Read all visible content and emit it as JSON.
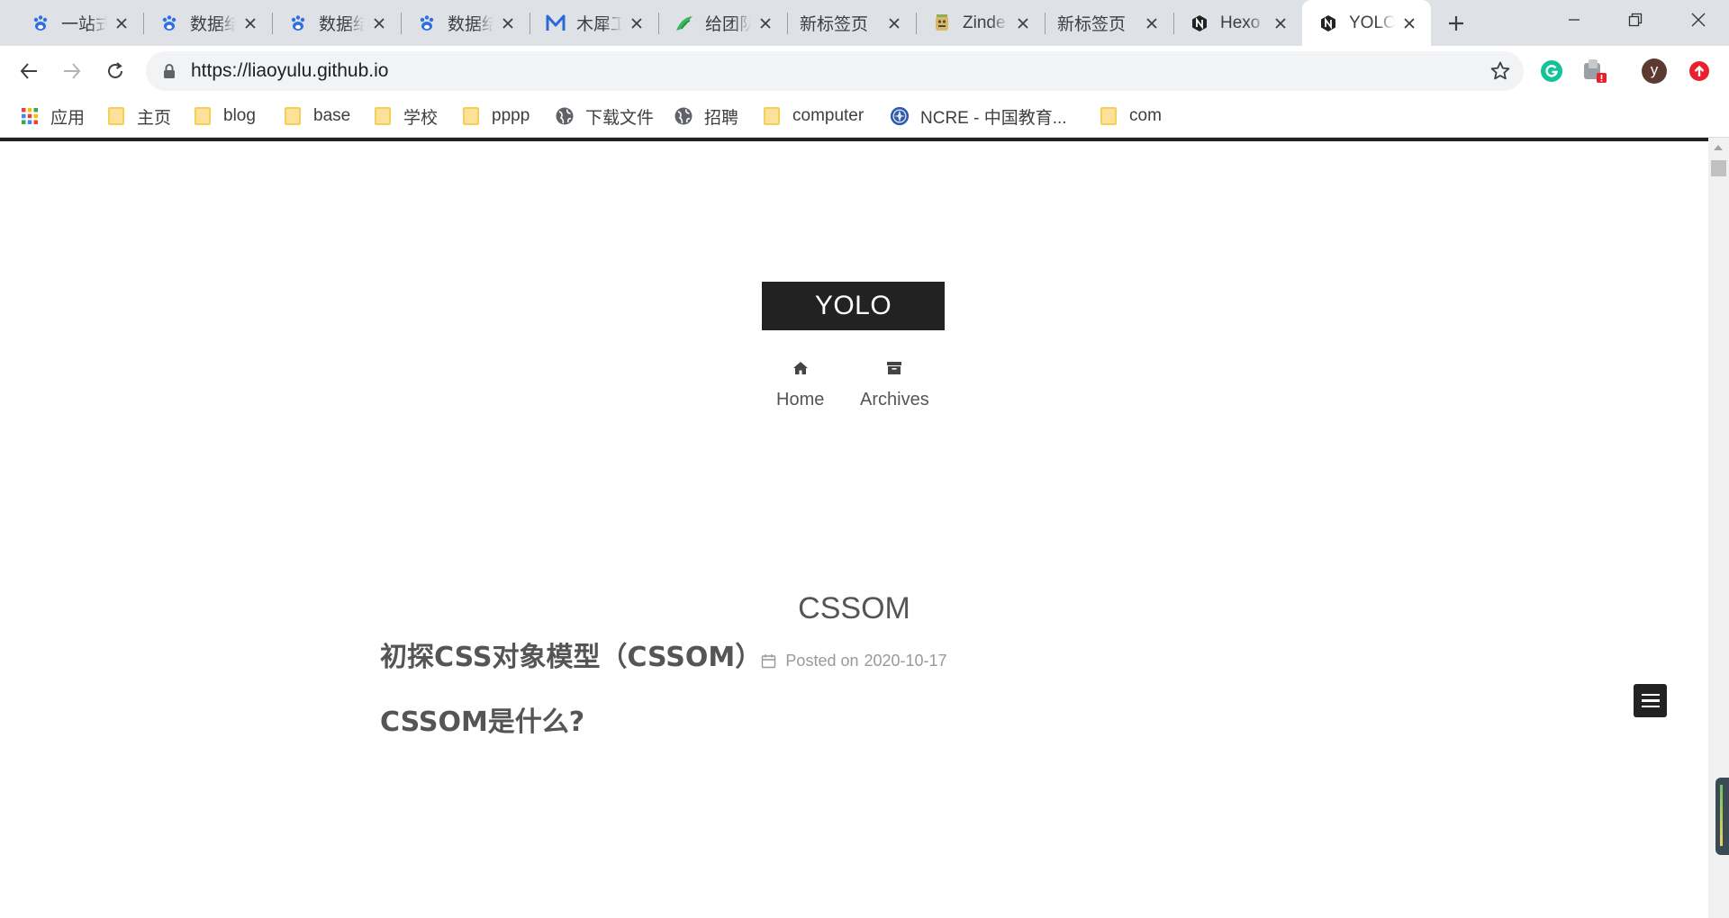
{
  "browser": {
    "tabs": [
      {
        "title": "一站式",
        "favicon": "baidu-paw-icon"
      },
      {
        "title": "数据结构",
        "favicon": "baidu-paw-icon"
      },
      {
        "title": "数据结构",
        "favicon": "baidu-paw-icon"
      },
      {
        "title": "数据结构",
        "favicon": "baidu-paw-icon"
      },
      {
        "title": "木犀工作室",
        "favicon": "m-logo-icon"
      },
      {
        "title": "给团队",
        "favicon": "green-bird-icon"
      },
      {
        "title": "新标签页",
        "favicon": ""
      },
      {
        "title": "Zinde",
        "favicon": "mascot-icon"
      },
      {
        "title": "新标签页",
        "favicon": ""
      },
      {
        "title": "Hexo",
        "favicon": "next-n-icon"
      },
      {
        "title": "YOLO",
        "favicon": "next-n-icon",
        "active": true
      }
    ],
    "url": "https://liaoyulu.github.io",
    "profile_initial": "y",
    "bookmarks": [
      {
        "label": "应用",
        "icon": "apps-grid-icon"
      },
      {
        "label": "主页",
        "icon": "folder-icon"
      },
      {
        "label": "blog",
        "icon": "folder-icon"
      },
      {
        "label": "base",
        "icon": "folder-icon"
      },
      {
        "label": "学校",
        "icon": "folder-icon"
      },
      {
        "label": "pppp",
        "icon": "folder-icon"
      },
      {
        "label": "下载文件",
        "icon": "globe-icon"
      },
      {
        "label": "招聘",
        "icon": "globe-icon"
      },
      {
        "label": "computer",
        "icon": "folder-icon"
      },
      {
        "label": "NCRE - 中国教育...",
        "icon": "ncre-logo-icon"
      },
      {
        "label": "com",
        "icon": "folder-icon"
      }
    ],
    "colors": {
      "tab_strip": "#dee1e6",
      "omnibox": "#f1f3f4"
    }
  },
  "site": {
    "brand": "YOLO",
    "menu": [
      {
        "label": "Home",
        "icon": "home-icon"
      },
      {
        "label": "Archives",
        "icon": "archive-icon"
      }
    ]
  },
  "post": {
    "title": "CSSOM",
    "meta_label": "Posted on",
    "date": "2020-10-17",
    "headings": [
      "初探CSS对象模型（CSSOM）",
      "CSSOM是什么?"
    ]
  }
}
